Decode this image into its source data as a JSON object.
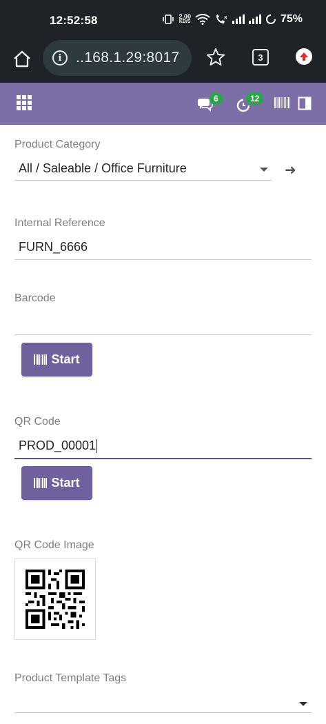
{
  "status_bar": {
    "time": "12:52:58",
    "net_speed_value": "2.00",
    "net_speed_unit": "KB/S",
    "battery": "75%"
  },
  "browser": {
    "url": "..168.1.29:8017",
    "tab_count": "3"
  },
  "navbar": {
    "messages_count": "6",
    "activities_count": "12"
  },
  "form": {
    "product_category": {
      "label": "Product Category",
      "value": "All / Saleable / Office Furniture"
    },
    "internal_reference": {
      "label": "Internal Reference",
      "value": "FURN_6666"
    },
    "barcode": {
      "label": "Barcode",
      "value": "",
      "start_label": "Start"
    },
    "qr_code": {
      "label": "QR Code",
      "value": "PROD_00001",
      "start_label": "Start"
    },
    "qr_code_image": {
      "label": "QR Code Image"
    },
    "product_template_tags": {
      "label": "Product Template Tags",
      "value": ""
    }
  }
}
